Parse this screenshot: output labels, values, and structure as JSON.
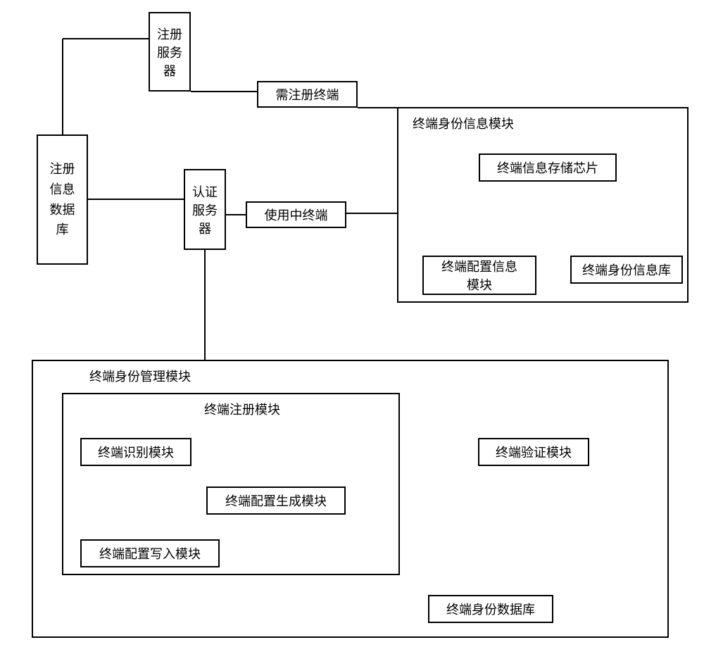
{
  "boxes": {
    "regServer": "注册\n服务\n器",
    "regTerminal": "需注册终端",
    "regDb": "注册\n信息\n数据\n库",
    "authServer": "认证\n服务\n器",
    "inUseTerminal": "使用中终端",
    "idInfoModuleTitle": "终端身份信息模块",
    "storageChip": "终端信息存储芯片",
    "configInfoModule": "终端配置信息\n模块",
    "idInfoLib": "终端身份信息库",
    "idMgmtModuleTitle": "终端身份管理模块",
    "regModuleTitle": "终端注册模块",
    "recogModule": "终端识别模块",
    "configGenModule": "终端配置生成模块",
    "configWriteModule": "终端配置写入模块",
    "verifyModule": "终端验证模块",
    "idDb": "终端身份数据库"
  }
}
